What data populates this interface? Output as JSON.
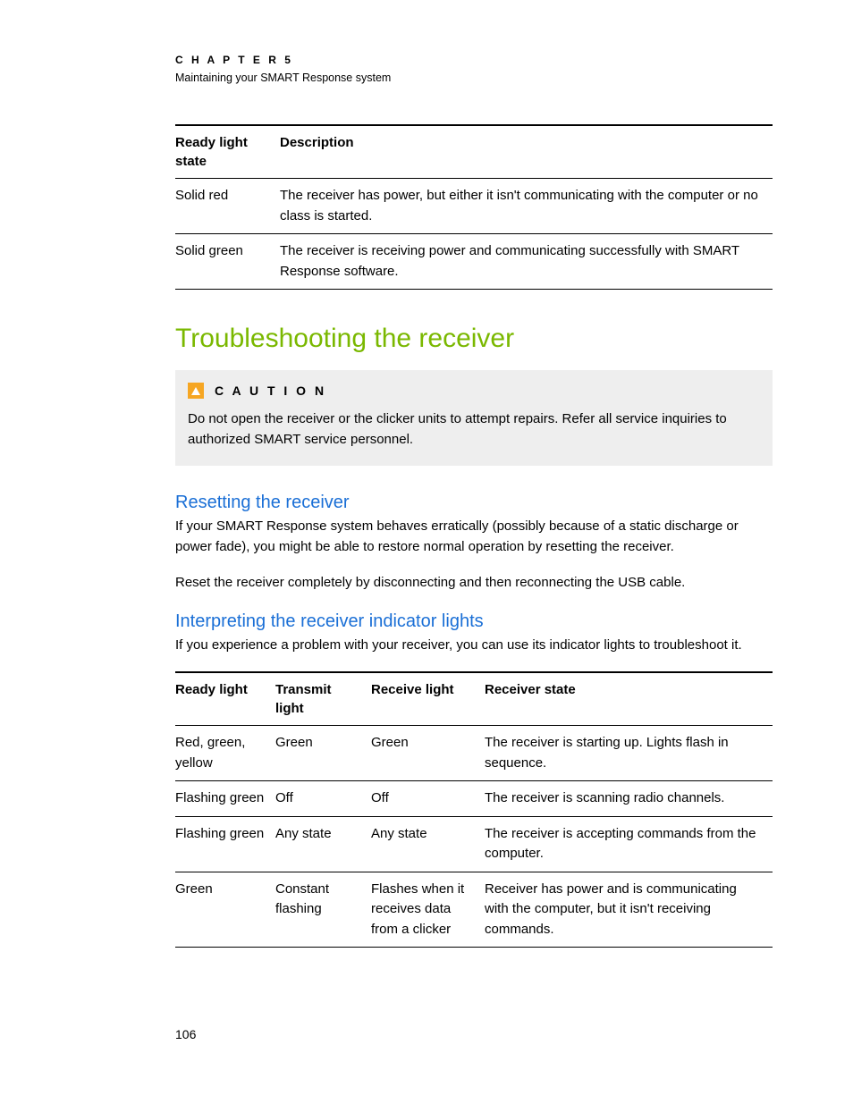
{
  "header": {
    "chapter_label": "C H A P T E R   5",
    "chapter_subtitle": "Maintaining your SMART Response system"
  },
  "table1": {
    "headers": {
      "col1": "Ready light state",
      "col2": "Description"
    },
    "rows": [
      {
        "state": "Solid red",
        "desc": "The receiver has power, but either it isn't communicating with the computer or no class is started."
      },
      {
        "state": "Solid green",
        "desc": "The receiver is receiving power and communicating successfully with SMART Response software."
      }
    ]
  },
  "section_title": "Troubleshooting the receiver",
  "caution": {
    "label": "C A U T I O N",
    "text": "Do not open the receiver or the clicker units to attempt repairs. Refer all service inquiries to authorized SMART service personnel."
  },
  "subsection1": {
    "title": "Resetting the receiver",
    "p1": "If your SMART Response system behaves erratically (possibly because of a static discharge or power fade), you might be able to restore normal operation by resetting the receiver.",
    "p2": "Reset the receiver completely by disconnecting and then reconnecting the USB cable."
  },
  "subsection2": {
    "title": "Interpreting the receiver indicator lights",
    "p1": "If you experience a problem with your receiver, you can use its indicator lights to troubleshoot it."
  },
  "table2": {
    "headers": {
      "c1": "Ready light",
      "c2": "Transmit light",
      "c3": "Receive light",
      "c4": "Receiver state"
    },
    "rows": [
      {
        "ready": "Red, green, yellow",
        "transmit": "Green",
        "receive": "Green",
        "state": "The receiver is starting up. Lights flash in sequence."
      },
      {
        "ready": "Flashing green",
        "transmit": "Off",
        "receive": "Off",
        "state": "The receiver is scanning radio channels."
      },
      {
        "ready": "Flashing green",
        "transmit": "Any state",
        "receive": "Any state",
        "state": "The receiver is accepting commands from the computer."
      },
      {
        "ready": "Green",
        "transmit": "Constant flashing",
        "receive": "Flashes when it receives data from a clicker",
        "state": "Receiver has power and is communicating with the computer, but it isn't receiving commands."
      }
    ]
  },
  "page_number": "106"
}
